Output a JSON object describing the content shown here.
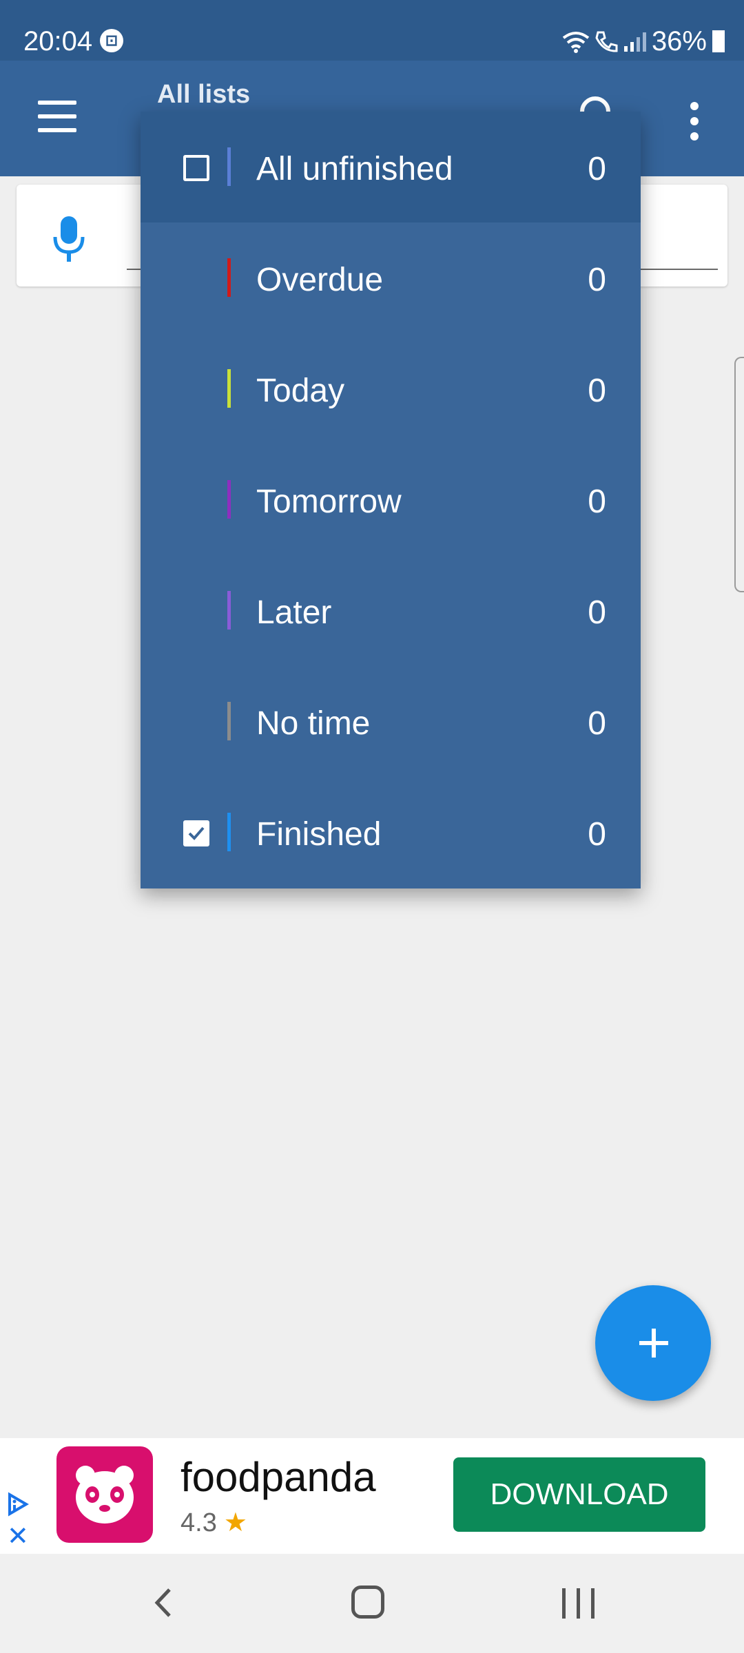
{
  "status_bar": {
    "time": "20:04",
    "battery": "36%",
    "icons": [
      "wifi-icon",
      "call-icon",
      "signal-icon",
      "battery-icon"
    ]
  },
  "app_bar": {
    "title": "All lists",
    "icons": [
      "menu-icon",
      "search-icon",
      "more-vert-icon"
    ]
  },
  "input": {
    "icon": "mic-icon"
  },
  "dropdown": {
    "items": [
      {
        "label": "All unfinished",
        "count": "0",
        "color": "#5b7fd6",
        "checkbox": "unchecked",
        "selected": true
      },
      {
        "label": "Overdue",
        "count": "0",
        "color": "#d11a1a"
      },
      {
        "label": "Today",
        "count": "0",
        "color": "#c8e03a"
      },
      {
        "label": "Tomorrow",
        "count": "0",
        "color": "#8e2fbf"
      },
      {
        "label": "Later",
        "count": "0",
        "color": "#8a5cd8"
      },
      {
        "label": "No time",
        "count": "0",
        "color": "#8c8c8c"
      },
      {
        "label": "Finished",
        "count": "0",
        "color": "#1e90f0",
        "checkbox": "checked"
      }
    ]
  },
  "fab": {
    "icon": "plus-icon",
    "color": "#1a8de8"
  },
  "ad": {
    "title": "foodpanda",
    "rating": "4.3",
    "button": "DOWNLOAD",
    "brand_color": "#d80f6d",
    "button_color": "#0c8a58"
  },
  "nav_bar": {
    "icons": [
      "back-icon",
      "home-icon",
      "recents-icon"
    ]
  }
}
